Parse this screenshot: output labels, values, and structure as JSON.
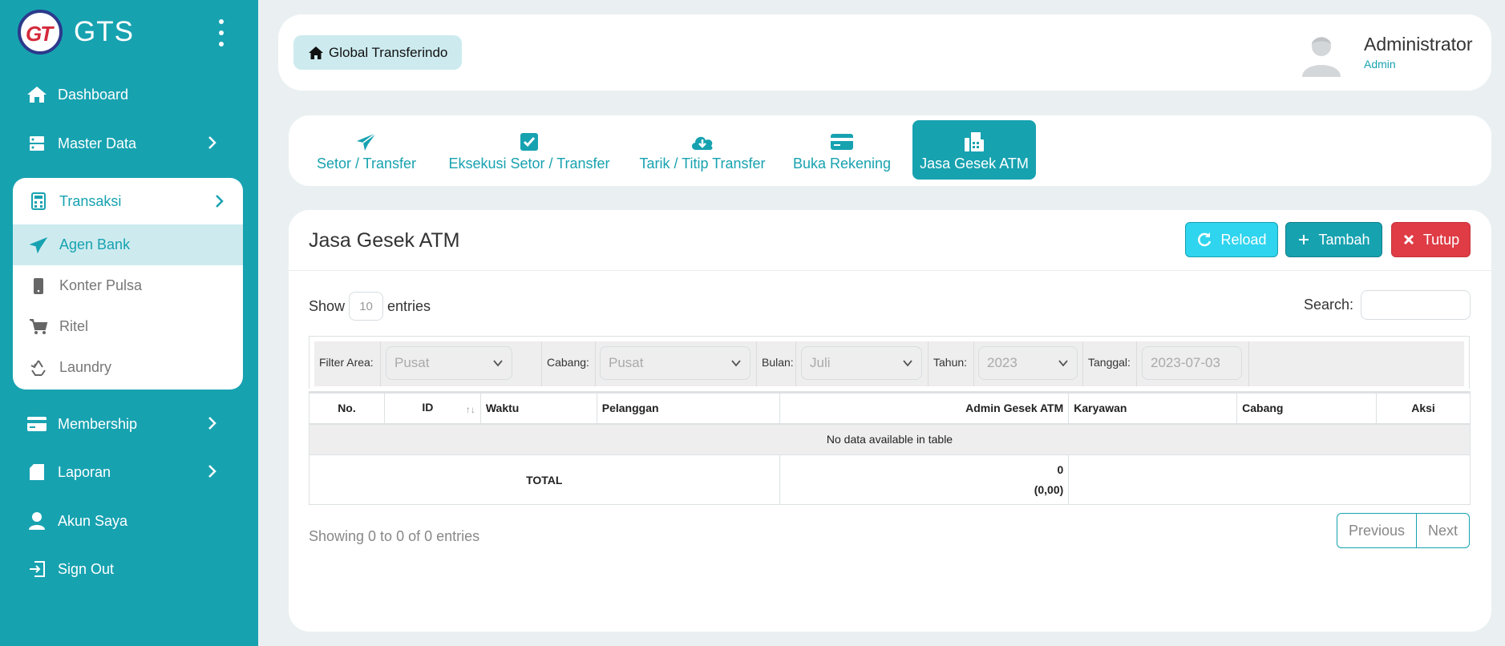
{
  "brand": {
    "logo_text": "GT",
    "title": "GTS"
  },
  "sidebar": {
    "items": [
      {
        "label": "Dashboard",
        "icon": "home-icon"
      },
      {
        "label": "Master Data",
        "icon": "server-icon"
      },
      {
        "label": "Transaksi",
        "icon": "calculator-icon"
      },
      {
        "label": "Membership",
        "icon": "credit-card-icon"
      },
      {
        "label": "Laporan",
        "icon": "file-icon"
      },
      {
        "label": "Akun Saya",
        "icon": "user-icon"
      },
      {
        "label": "Sign Out",
        "icon": "sign-out-icon"
      }
    ],
    "submenu": [
      {
        "label": "Agen Bank",
        "icon": "paper-plane-icon"
      },
      {
        "label": "Konter Pulsa",
        "icon": "mobile-icon"
      },
      {
        "label": "Ritel",
        "icon": "cart-icon"
      },
      {
        "label": "Laundry",
        "icon": "recycle-icon"
      }
    ]
  },
  "header": {
    "home_label": "Global Transferindo",
    "user_name": "Administrator",
    "user_role": "Admin"
  },
  "tabs": [
    {
      "label": "Setor / Transfer",
      "icon": "paper-plane-icon"
    },
    {
      "label": "Eksekusi Setor / Transfer",
      "icon": "check-square-icon"
    },
    {
      "label": "Tarik / Titip Transfer",
      "icon": "cloud-download-icon"
    },
    {
      "label": "Buka Rekening",
      "icon": "credit-card-icon"
    },
    {
      "label": "Jasa Gesek ATM",
      "icon": "fax-icon",
      "active": true
    }
  ],
  "main": {
    "title": "Jasa Gesek ATM",
    "buttons": {
      "reload": "Reload",
      "tambah": "Tambah",
      "tutup": "Tutup"
    },
    "show_label": "Show",
    "entries_value": "10",
    "entries_label": "entries",
    "search_label": "Search:",
    "filters": {
      "area_label": "Filter Area:",
      "area_value": "Pusat",
      "cabang_label": "Cabang:",
      "cabang_value": "Pusat",
      "bulan_label": "Bulan:",
      "bulan_value": "Juli",
      "tahun_label": "Tahun:",
      "tahun_value": "2023",
      "tanggal_label": "Tanggal:",
      "tanggal_value": "2023-07-03"
    },
    "table": {
      "columns": [
        "No.",
        "ID",
        "Waktu",
        "Pelanggan",
        "Admin Gesek ATM",
        "Karyawan",
        "Cabang",
        "Aksi"
      ],
      "empty_text": "No data available in table",
      "total_label": "TOTAL",
      "total_count": "0",
      "total_amount": "(0,00)"
    },
    "info_text": "Showing 0 to 0 of 0 entries",
    "pager": {
      "previous": "Previous",
      "next": "Next"
    }
  },
  "colors": {
    "primary": "#17a2b0",
    "info": "#2fd4ee",
    "danger": "#df3c45",
    "background": "#eaf0f2"
  }
}
